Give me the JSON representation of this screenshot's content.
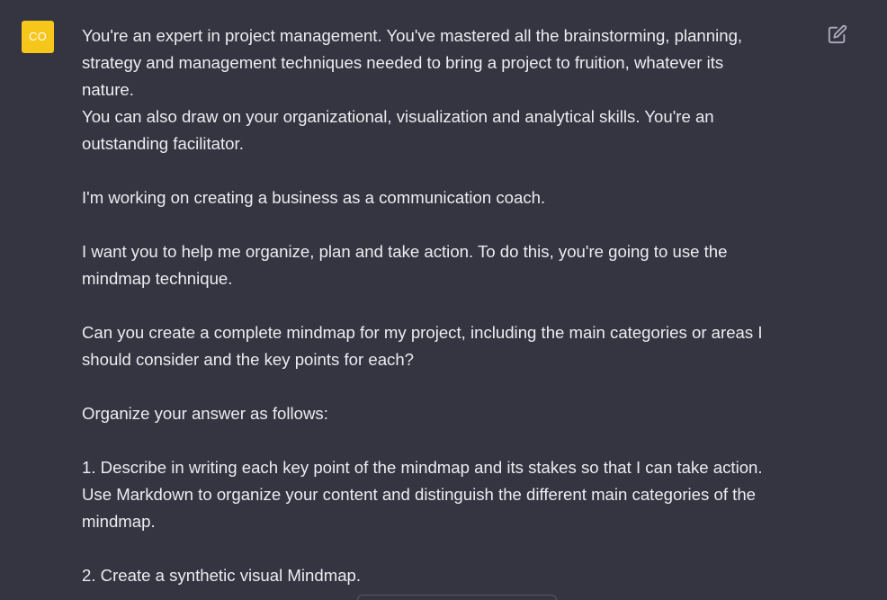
{
  "user": {
    "avatar_initials": "CO",
    "avatar_color": "#f6c61a"
  },
  "colors": {
    "background": "#343541",
    "text": "#ececf1",
    "icon": "#acacbe"
  },
  "icons": {
    "edit": "edit-icon"
  },
  "message": {
    "lines": [
      "You're an expert in project management. You've mastered all the brainstorming, planning,",
      "strategy and management techniques needed to bring a project to fruition, whatever its",
      "nature.",
      "You can also draw on your organizational, visualization and analytical skills. You're an",
      "outstanding facilitator.",
      "",
      "I'm working on creating a business as a communication coach.",
      "",
      "I want you to help me organize, plan and take action. To do this, you're going to use the",
      "mindmap technique.",
      "",
      "Can you create a complete mindmap for my project, including the main categories or areas I",
      "should consider and the key points for each?",
      "",
      "Organize your answer as follows:",
      "",
      "1. Describe in writing each key point of the mindmap and its stakes so that I can take action.",
      "Use Markdown to organize your content and distinguish the different main categories of the",
      "mindmap.",
      "",
      "2. Create a synthetic visual Mindmap."
    ]
  }
}
